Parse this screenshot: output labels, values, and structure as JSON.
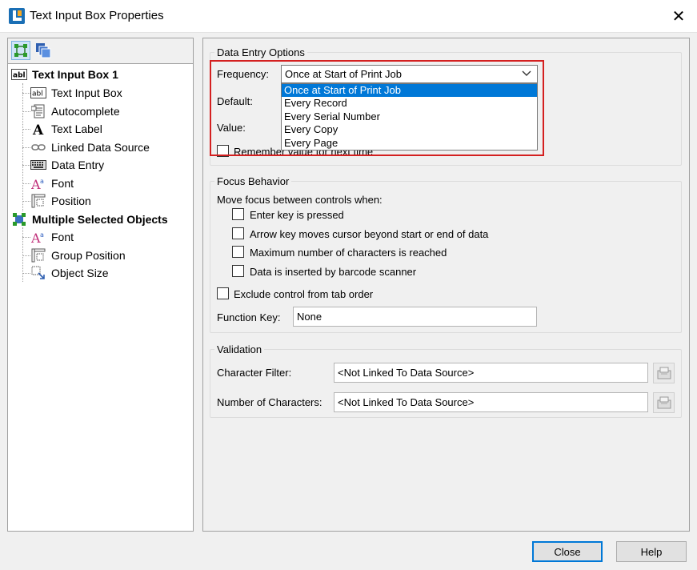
{
  "window": {
    "title": "Text Input Box Properties",
    "close_glyph": "✕"
  },
  "tree": {
    "items": [
      {
        "label": "Text Input Box 1",
        "icon": "textbox-icon",
        "bold": true
      },
      {
        "label": "Text Input Box",
        "icon": "textbox-icon"
      },
      {
        "label": "Autocomplete",
        "icon": "autocomplete-icon"
      },
      {
        "label": "Text Label",
        "icon": "text-label-icon"
      },
      {
        "label": "Linked Data Source",
        "icon": "link-icon"
      },
      {
        "label": "Data Entry",
        "icon": "keyboard-icon",
        "selected": true
      },
      {
        "label": "Font",
        "icon": "font-icon"
      },
      {
        "label": "Position",
        "icon": "position-icon"
      },
      {
        "label": "Multiple Selected Objects",
        "icon": "multi-select-icon",
        "bold": true
      },
      {
        "label": "Font",
        "icon": "font-icon"
      },
      {
        "label": "Group Position",
        "icon": "position-icon"
      },
      {
        "label": "Object Size",
        "icon": "object-size-icon"
      }
    ]
  },
  "data_entry": {
    "group_title": "Data Entry Options",
    "frequency_label": "Frequency:",
    "frequency_value": "Once at Start of Print Job",
    "frequency_options": [
      "Once at Start of Print Job",
      "Every Record",
      "Every Serial Number",
      "Every Copy",
      "Every Page"
    ],
    "default_label": "Default:",
    "value_label": "Value:",
    "remember_label": "Remember value for next time"
  },
  "focus": {
    "group_title": "Focus Behavior",
    "move_focus_label": "Move focus between controls when:",
    "options": [
      "Enter key is pressed",
      "Arrow key moves cursor beyond start or end of data",
      "Maximum number of characters is reached",
      "Data is inserted by barcode scanner"
    ],
    "exclude_label": "Exclude control from tab order",
    "function_key_label": "Function Key:",
    "function_key_value": "None"
  },
  "validation": {
    "group_title": "Validation",
    "char_filter_label": "Character Filter:",
    "char_filter_value": "<Not Linked To Data Source>",
    "num_chars_label": "Number of Characters:",
    "num_chars_value": "<Not Linked To Data Source>"
  },
  "buttons": {
    "close": "Close",
    "help": "Help"
  },
  "colors": {
    "highlight": "#d42020",
    "selection": "#0078d7"
  }
}
